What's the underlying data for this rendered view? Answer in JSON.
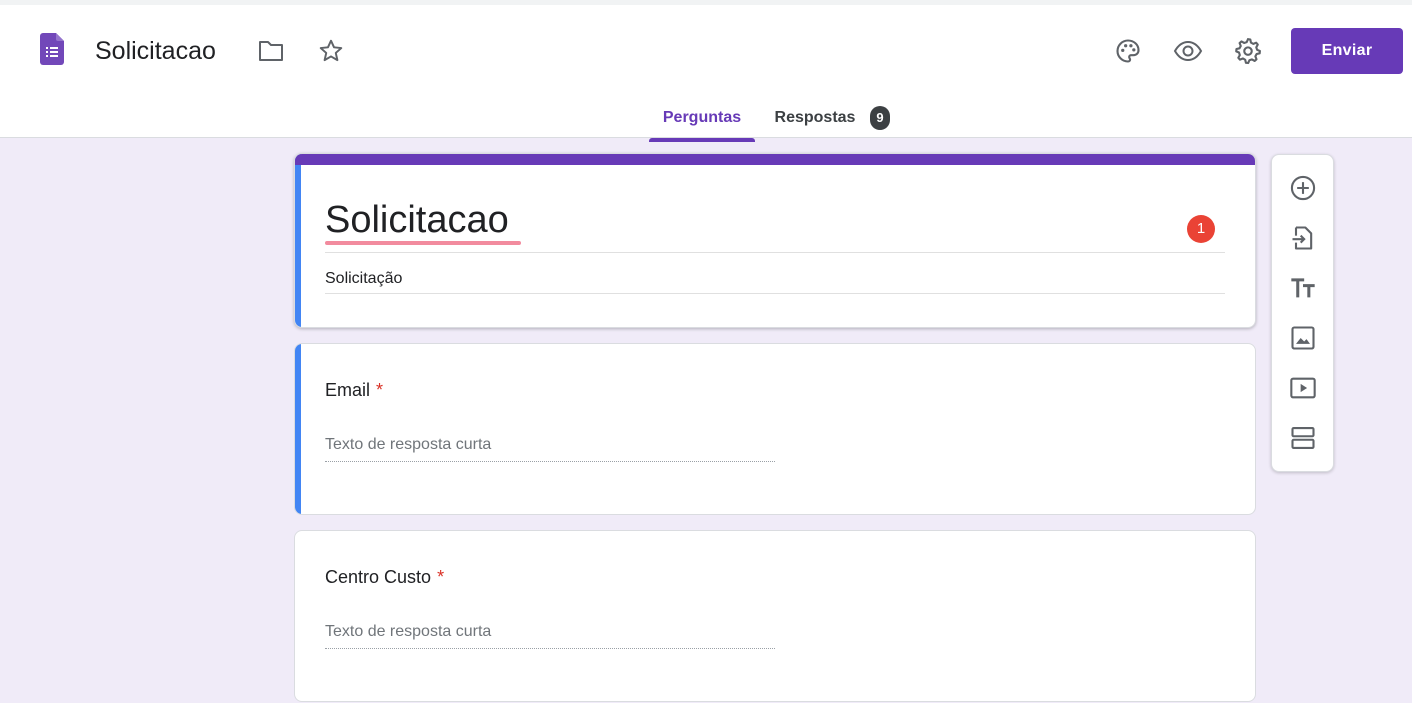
{
  "header": {
    "doc_title": "Solicitacao",
    "icons": {
      "doc": "forms-doc-icon",
      "folder": "folder-icon",
      "star": "star-icon",
      "palette": "palette-icon",
      "preview": "eye-icon",
      "settings": "gear-icon"
    },
    "send_label": "Enviar",
    "colors": {
      "accent": "#673ab7",
      "active_bar": "#4285f4",
      "error": "#ea4335",
      "required": "#d93025"
    }
  },
  "tabs": {
    "questions_label": "Perguntas",
    "responses_label": "Respostas",
    "responses_count": "9"
  },
  "form": {
    "title": "Solicitacao",
    "description": "Solicitação",
    "error_count": "1"
  },
  "questions": [
    {
      "label": "Email",
      "required_mark": "*",
      "placeholder": "Texto de resposta curta"
    },
    {
      "label": "Centro Custo",
      "required_mark": "*",
      "placeholder": "Texto de resposta curta"
    }
  ],
  "toolbar": {
    "items": [
      "add-question-icon",
      "import-questions-icon",
      "add-title-icon",
      "add-image-icon",
      "add-video-icon",
      "add-section-icon"
    ]
  }
}
